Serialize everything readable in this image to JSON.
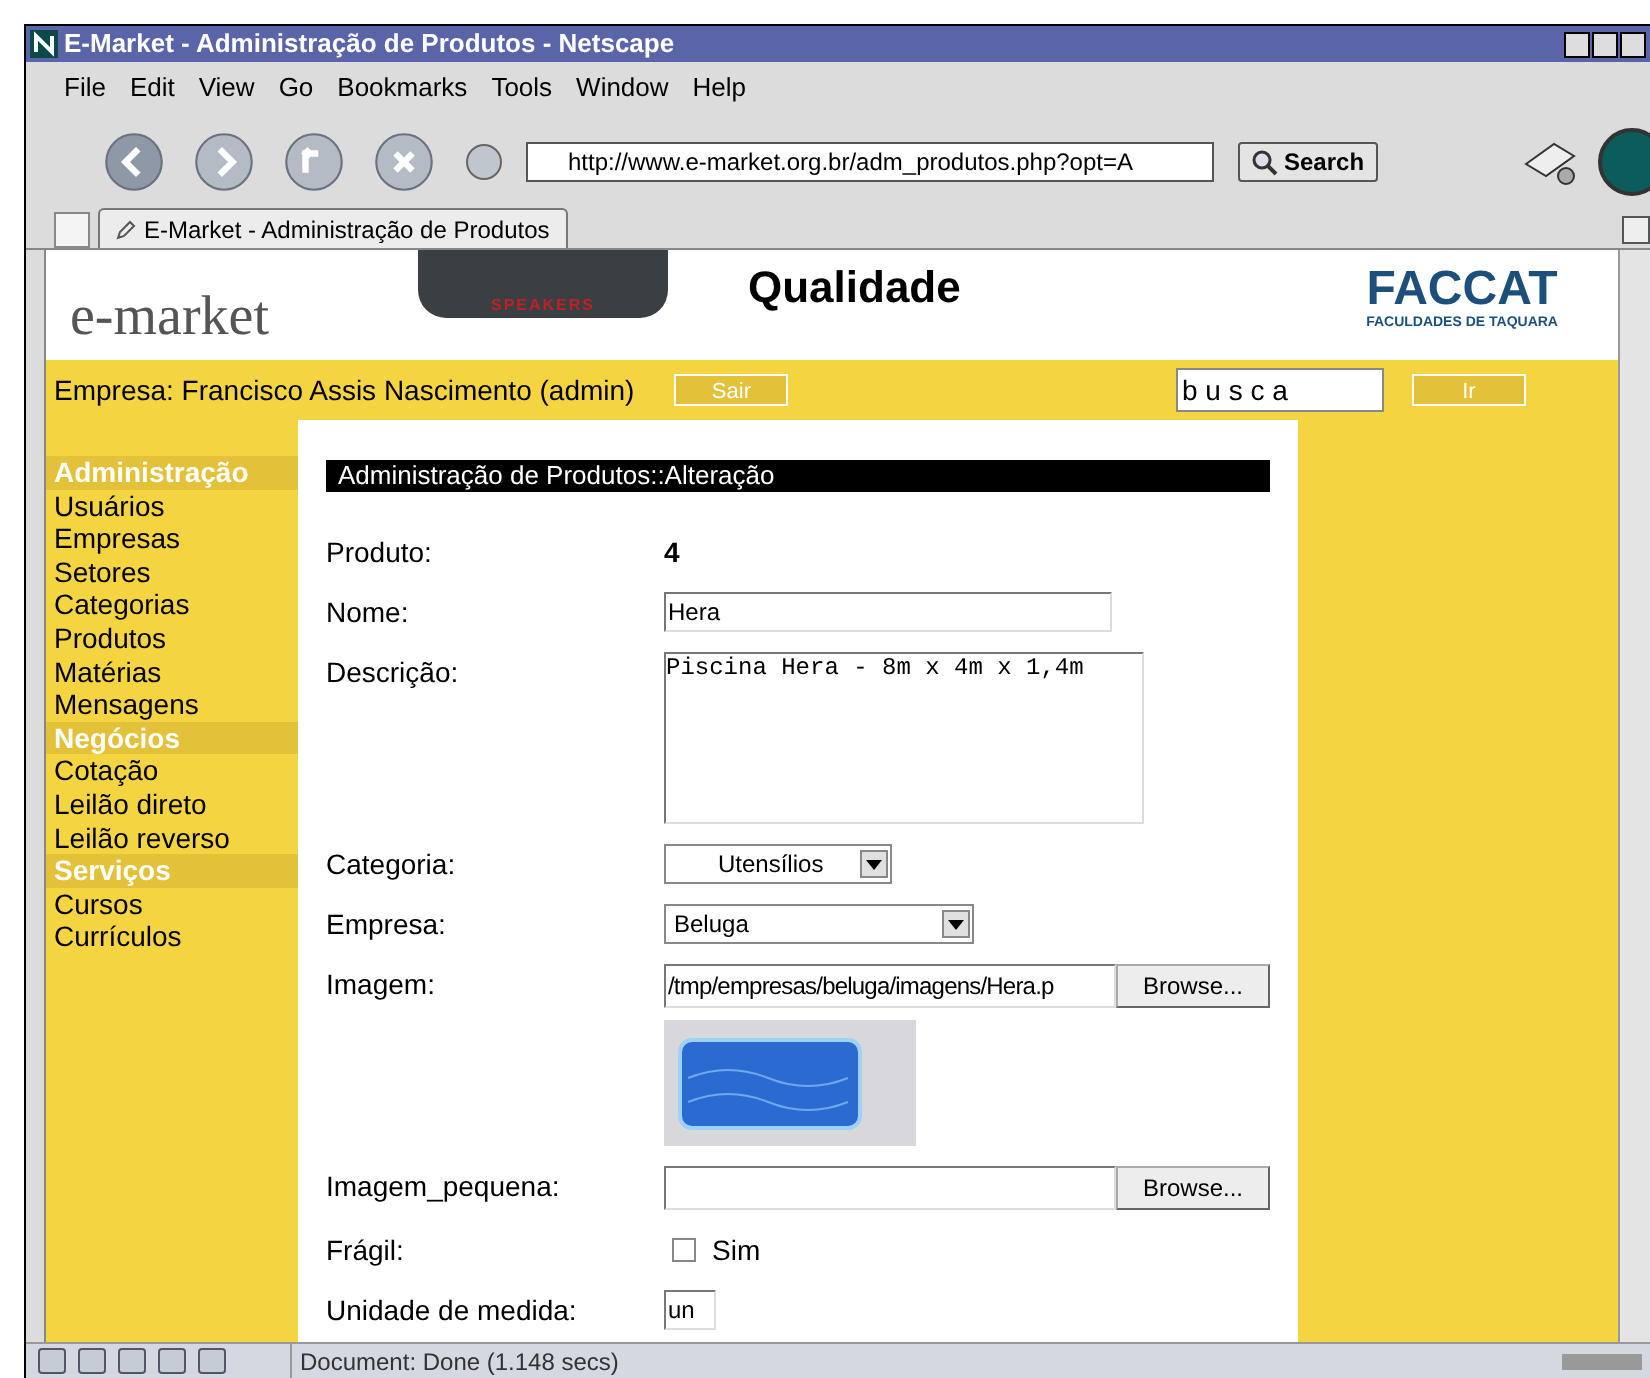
{
  "window": {
    "title": "E-Market - Administração de Produtos - Netscape"
  },
  "menu": [
    "File",
    "Edit",
    "View",
    "Go",
    "Bookmarks",
    "Tools",
    "Window",
    "Help"
  ],
  "toolbar": {
    "url": "http://www.e-market.org.br/adm_produtos.php?opt=A",
    "search_button": "Search"
  },
  "tabs": [
    {
      "label": "E-Market - Administração de Produtos",
      "selected": true
    }
  ],
  "header": {
    "logo": "e-market",
    "sponsor_logo": "SPEAKERS",
    "slogan": "Qualidade",
    "faccat": "FACCAT",
    "faccat_sub": "FACULDADES DE TAQUARA"
  },
  "user_bar": {
    "company": "Empresa: Francisco Assis Nascimento (admin)",
    "logout": "Sair",
    "search_value": "b u s c a",
    "go": "Ir"
  },
  "sidebar": [
    {
      "kind": "section",
      "label": "Administração"
    },
    {
      "kind": "link",
      "label": "Usuários"
    },
    {
      "kind": "link",
      "label": "Empresas"
    },
    {
      "kind": "link",
      "label": "Setores"
    },
    {
      "kind": "link",
      "label": "Categorias"
    },
    {
      "kind": "link",
      "label": "Produtos"
    },
    {
      "kind": "link",
      "label": "Matérias"
    },
    {
      "kind": "link",
      "label": "Mensagens"
    },
    {
      "kind": "section",
      "label": "Negócios"
    },
    {
      "kind": "link",
      "label": "Cotação"
    },
    {
      "kind": "link",
      "label": "Leilão direto"
    },
    {
      "kind": "link",
      "label": "Leilão reverso"
    },
    {
      "kind": "section",
      "label": "Serviços"
    },
    {
      "kind": "link",
      "label": "Cursos"
    },
    {
      "kind": "link",
      "label": "Currículos"
    }
  ],
  "page_heading": "Administração de Produtos::Alteração",
  "form": [
    {
      "kind": "static",
      "label": "Produto:",
      "value": "4"
    },
    {
      "kind": "text",
      "label": "Nome:",
      "value": "Hera"
    },
    {
      "kind": "textarea",
      "label": "Descrição:",
      "value": "Piscina Hera - 8m x 4m x 1,4m"
    },
    {
      "kind": "select",
      "label": "Categoria:",
      "value": "Utensílios",
      "centered": true
    },
    {
      "kind": "select",
      "label": "Empresa:",
      "value": "Beluga",
      "centered": false
    },
    {
      "kind": "file",
      "label": "Imagem:",
      "value": "/tmp/empresas/beluga/imagens/Hera.p",
      "button": "Browse...",
      "has_image": true
    },
    {
      "kind": "file",
      "label": "Imagem_pequena:",
      "button": "Browse..."
    },
    {
      "kind": "checkbox",
      "label": "Frágil:",
      "option": "Sim",
      "checked": false
    },
    {
      "kind": "short",
      "label": "Unidade de medida:",
      "value": "un"
    }
  ],
  "status_bar": "Document: Done (1.148 secs)"
}
